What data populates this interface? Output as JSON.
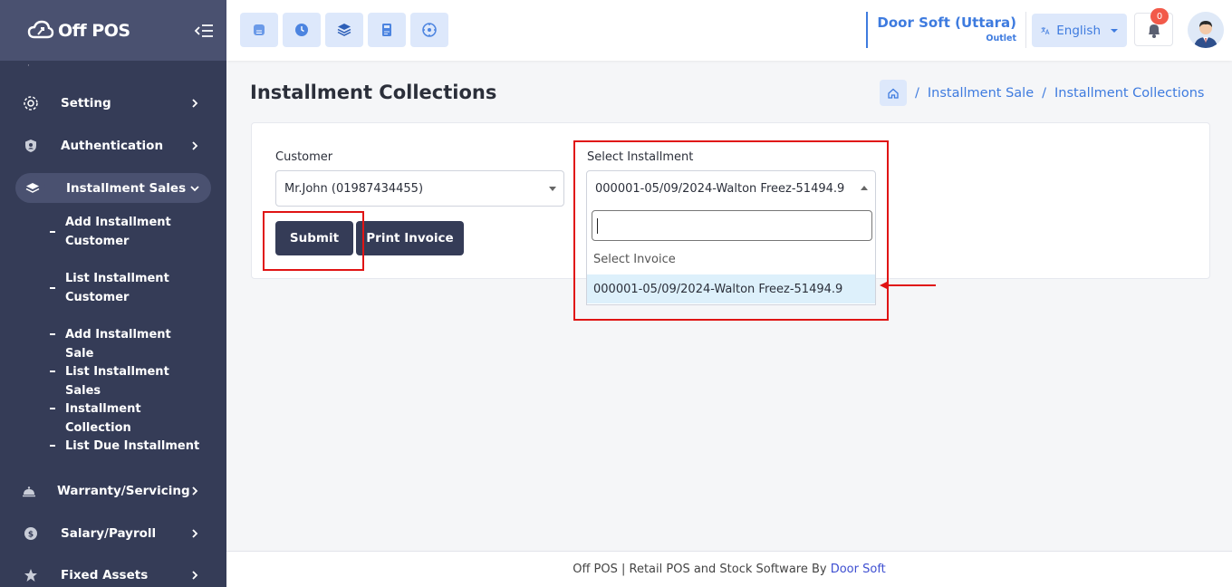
{
  "app": {
    "logo_text": "Off POS"
  },
  "sidebar": {
    "items": [
      {
        "label": "Setting",
        "icon": "gear-icon"
      },
      {
        "label": "Authentication",
        "icon": "shield-user-icon"
      },
      {
        "label": "Installment Sales",
        "icon": "layers-icon",
        "active": true
      },
      {
        "label": "Warranty/Servicing",
        "icon": "service-bell-icon"
      },
      {
        "label": "Salary/Payroll",
        "icon": "dollar-icon"
      },
      {
        "label": "Fixed Assets",
        "icon": "asset-icon"
      }
    ],
    "sub_items": [
      "Add Installment Customer",
      "List Installment Customer",
      "Add Installment Sale",
      "List Installment Sales",
      "Installment Collection",
      "List Due Installment"
    ]
  },
  "header": {
    "outlet_name": "Door Soft (Uttara)",
    "outlet_sub": "Outlet",
    "language": "English",
    "notification_count": "0"
  },
  "page": {
    "title": "Installment Collections",
    "breadcrumb": [
      "Installment Sale",
      "Installment Collections"
    ]
  },
  "form": {
    "customer_label": "Customer",
    "customer_value": "Mr.John (01987434455)",
    "installment_label": "Select Installment",
    "installment_value": "000001-05/09/2024-Walton Freez-51494.9",
    "submit_label": "Submit",
    "print_label": "Print Invoice"
  },
  "dropdown": {
    "search_value": "",
    "options": [
      "Select Invoice",
      "000001-05/09/2024-Walton Freez-51494.9"
    ]
  },
  "footer": {
    "text": "Off POS | Retail POS and Stock Software By ",
    "link": "Door Soft"
  },
  "colors": {
    "sidebar": "#353c57",
    "accent": "#3e7bdf",
    "highlight": "#e01414"
  }
}
